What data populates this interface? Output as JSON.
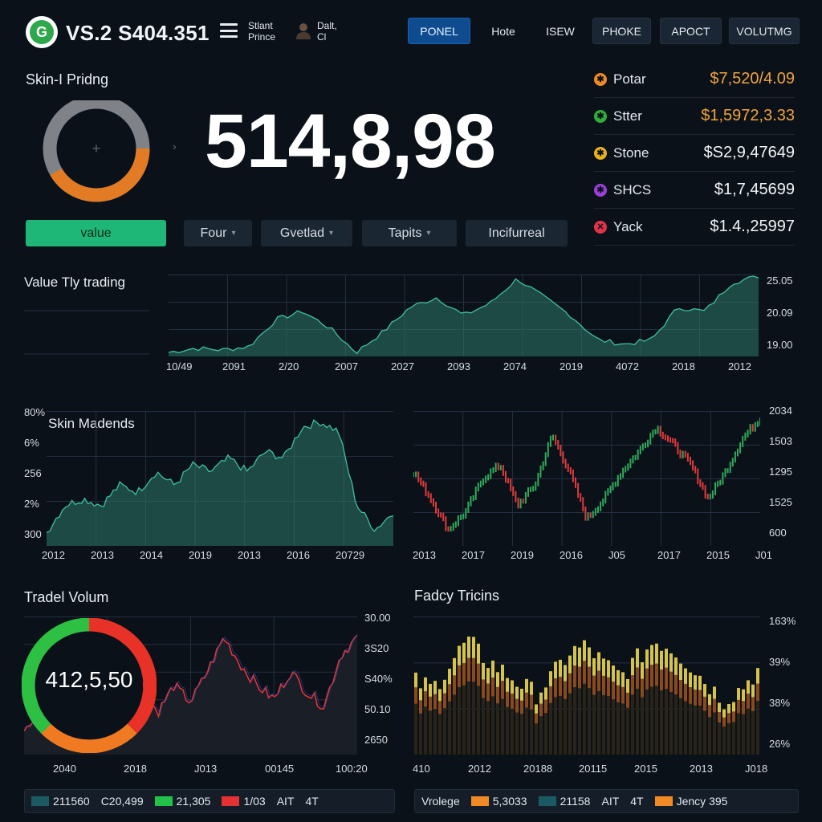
{
  "header": {
    "title": "VS.2 S404.351",
    "sub_a_line1": "Stlant",
    "sub_a_line2": "Prince",
    "sub_b_line1": "Dalt,",
    "sub_b_line2": "Cl",
    "nav": [
      "PONEL",
      "Hote",
      "ISEW",
      "PHOKE",
      "APOCT",
      "VOLUTMG"
    ],
    "active_nav": "PONEL"
  },
  "pricing": {
    "title": "Skin-I Pridng",
    "big_number": "514,8,98",
    "buttons": [
      {
        "label": "value",
        "has_caret": false
      },
      {
        "label": "Four",
        "has_caret": true
      },
      {
        "label": "Gvetlad",
        "has_caret": true
      },
      {
        "label": "Tapits",
        "has_caret": true
      },
      {
        "label": "Incifurreal",
        "has_caret": false
      }
    ]
  },
  "tickers": [
    {
      "name": "Potar",
      "value": "$7,520/4.09",
      "icon_color": "#f08a24",
      "value_color": "#f0a33a",
      "icon": "✱"
    },
    {
      "name": "Stter",
      "value": "$1,5972,3.33",
      "icon_color": "#2fae3e",
      "value_color": "#f0a33a",
      "icon": "✱"
    },
    {
      "name": "Stone",
      "value": "$S2,9,47649",
      "icon_color": "#e8b021",
      "value_color": "#f2f4f6",
      "icon": "✱"
    },
    {
      "name": "SHCS",
      "value": "$1,7,45699",
      "icon_color": "#9b3fd6",
      "value_color": "#f2f4f6",
      "icon": "✱"
    },
    {
      "name": "Yack",
      "value": "$1.4.,25997",
      "icon_color": "#e0334a",
      "value_color": "#f2f4f6",
      "icon": "✕"
    }
  ],
  "charts": {
    "value_trading": {
      "title": "Value Tly trading",
      "x_labels": [
        "10/49",
        "2091",
        "2/20",
        "2007",
        "2027",
        "2093",
        "2074",
        "2019",
        "4072",
        "2018",
        "2012"
      ],
      "y_labels": [
        "25.05",
        "20.09",
        "19.00"
      ],
      "color": "#2d7a6a"
    },
    "skin_madends": {
      "title": "Skin Madends",
      "x_labels": [
        "2012",
        "2013",
        "2014",
        "2019",
        "2013",
        "2016",
        "20729"
      ],
      "y_labels": [
        "80%",
        "6%",
        "256",
        "2%",
        "300"
      ],
      "color": "#2d7a6a"
    },
    "candles": {
      "x_labels": [
        "2013",
        "2017",
        "2019",
        "2016",
        "J05",
        "2017",
        "2015",
        "J01"
      ],
      "y_labels": [
        "2034",
        "1503",
        "1295",
        "1525",
        "600"
      ]
    },
    "trade_volume": {
      "title": "Tradel Volum",
      "donut_value": "412,5,50",
      "x_labels": [
        "2040",
        "2018",
        "J013",
        "00145",
        "100:20"
      ],
      "y_labels": [
        "30.00",
        "3S20",
        "S40%",
        "50.10",
        "2650"
      ]
    },
    "fadcy": {
      "title": "Fadcy Tricins",
      "x_labels": [
        "410",
        "2012",
        "20188",
        "20115",
        "2015",
        "2013",
        "J018"
      ],
      "y_labels": [
        "163%",
        "39%",
        "38%",
        "26%"
      ]
    }
  },
  "footer_left": [
    {
      "text": "211560",
      "swatch": "#1c5a63"
    },
    {
      "text": "C20,499",
      "swatch": null
    },
    {
      "text": "21,305",
      "swatch": "#22c24a"
    },
    {
      "text": "1/03",
      "swatch": "#e23232"
    },
    {
      "text": "AIT",
      "swatch": null
    },
    {
      "text": "4T",
      "swatch": null
    }
  ],
  "footer_right": [
    {
      "text": "Vrolege",
      "swatch": null
    },
    {
      "text": "5,3033",
      "swatch": "#f08a24"
    },
    {
      "text": "21158",
      "swatch": "#1c5a63"
    },
    {
      "text": "AIT",
      "swatch": null
    },
    {
      "text": "4T",
      "swatch": null
    },
    {
      "text": "Jency 395",
      "swatch": "#f08a24"
    }
  ]
}
